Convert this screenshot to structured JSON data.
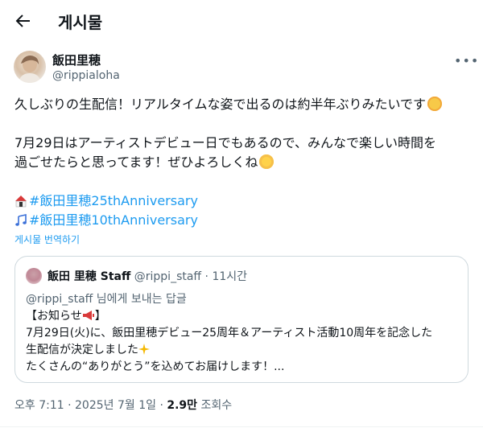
{
  "header": {
    "title": "게시물"
  },
  "author": {
    "name": "飯田里穂",
    "handle": "@rippialoha"
  },
  "post": {
    "line1": "久しぶりの生配信！リアルタイムな姿で出るのは約半年ぶりみたいです",
    "line2": "7月29日はアーティストデビュー日でもあるので、みんなで楽しい時間を",
    "line3": "過ごせたらと思ってます！ぜひよろしくね",
    "hashtags": [
      "#飯田里穂25thAnniversary",
      "#飯田里穂10thAnniversary"
    ],
    "translate_label": "게시물 번역하기"
  },
  "quote": {
    "name": "飯田 里穂 Staff",
    "handle": "@rippi_staff",
    "time": "· 11시간",
    "reply_to": "@rippi_staff 님에게 보내는 답글",
    "line1": "【お知らせ",
    "line1_end": "】",
    "line2": "7月29日(火)に、飯田里穂デビュー25周年＆アーティスト活動10周年を記念した",
    "line3": "生配信が決定しました",
    "line4": "たくさんの“ありがとう”を込めてお届けします！..."
  },
  "footer": {
    "time": "오후 7:11",
    "sep1": " · ",
    "date": "2025년 7월 1일",
    "sep2": " · ",
    "views": "2.9만",
    "views_label": " 조회수"
  },
  "colors": {
    "link": "#1d9bf0",
    "muted": "#536471",
    "border": "#cfd9de"
  },
  "icons": {
    "back": "arrow-left-icon",
    "more": "more-dots-icon"
  }
}
